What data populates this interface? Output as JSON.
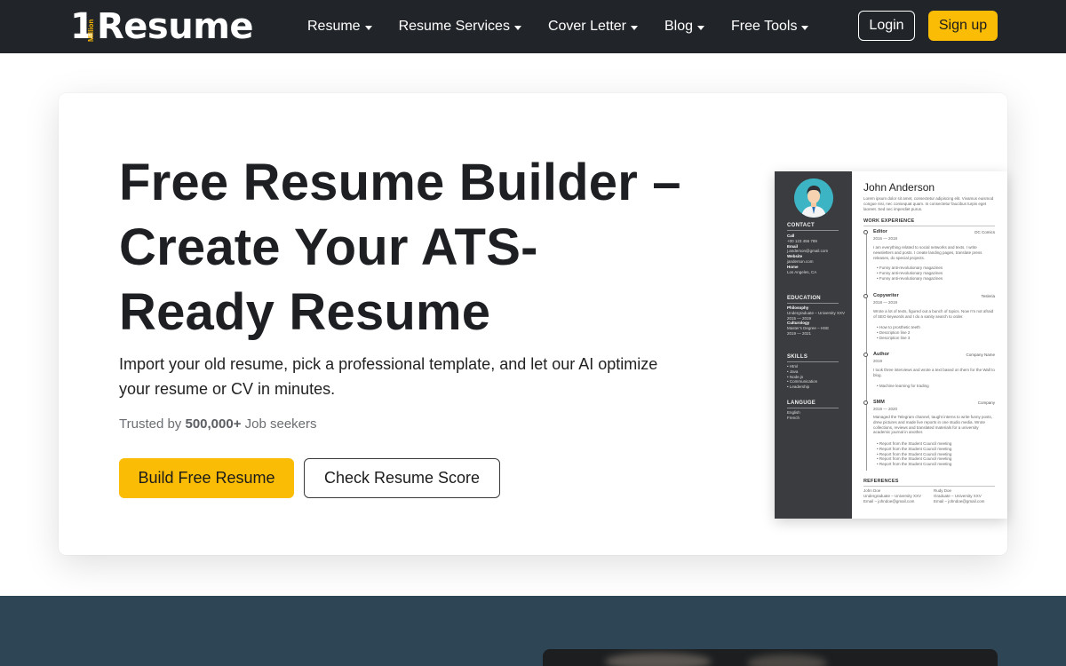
{
  "nav": {
    "logo_one": "1",
    "logo_million": "Million",
    "logo_word": "Resume",
    "menu": [
      {
        "label": "Resume"
      },
      {
        "label": "Resume Services"
      },
      {
        "label": "Cover Letter"
      },
      {
        "label": "Blog"
      },
      {
        "label": "Free Tools"
      }
    ],
    "login": "Login",
    "signup": "Sign up"
  },
  "hero": {
    "title": "Free Resume Builder – Create Your ATS-Ready Resume",
    "subtitle": "Import your old resume, pick a professional template, and let our AI optimize your resume or CV in minutes.",
    "trusted_prefix": "Trusted by",
    "trusted_count": "500,000+",
    "trusted_suffix": "Job seekers",
    "build_button": "Build Free Resume",
    "score_button": "Check Resume Score"
  },
  "preview": {
    "name": "John Anderson",
    "summary": "Lorem ipsum dolor sit amet, consectetur adipiscing elit. Vivamus euismod congue nisi, nec consequat quam. In consectetur faucibus turpis eget laoreet. Sed nec imperdiet purus.",
    "contact_heading": "CONTACT",
    "call_label": "Call",
    "call": "+00 123 456 789",
    "email_label": "Email",
    "email": "j.anderson@gmail.com",
    "website_label": "Website",
    "website": "janderson.com",
    "home_label": "Home",
    "home": "Los Angeles, CA",
    "education_heading": "EDUCATION",
    "edu1_title": "Philosophy",
    "edu1_detail": "Undergraduate – University XXV",
    "edu1_years": "2015 — 2019",
    "edu2_title": "Culturology",
    "edu2_detail": "Master's Degree – HSE",
    "edu2_years": "2019 — 2021",
    "skills_heading": "SKILLS",
    "skills": "• Html\n• Java\n• Node.js\n• Communication\n• Leadership",
    "language_heading": "LANGUGE",
    "languages": "English\nFrench",
    "work_heading": "WORK EXPERIENCE",
    "job1_title": "Editor",
    "job1_company": "DC Comics",
    "job1_years": "2016 — 2018",
    "job1_desc": "I am everything related to social networks and texts. I write newsletters and posts. I create landing pages, translate press releases, do special projects.",
    "job1_bullets": "• Funny anti-revolutionary magazines\n• Funny anti-revolutionary magazines\n• Funny anti-revolutionary magazines",
    "job2_title": "Copywriter",
    "job2_company": "Tesleria",
    "job2_years": "2018 — 2019",
    "job2_desc": "Wrote a lot of texts, figured out a bunch of topics. Now I'm not afraid of SEO keywords and I do a sanity search to order.",
    "job2_bullets": "• How to prosthetic teeth\n• Description line 2\n• Description line 3",
    "job3_title": "Author",
    "job3_company": "Company Name",
    "job3_years": "2019",
    "job3_desc": "I took three interviews and wrote a text based on them for the Wall to blog.",
    "job3_bullets": "• Machine learning for trading",
    "job4_title": "SMM",
    "job4_company": "Company",
    "job4_years": "2019 — 2020",
    "job4_desc": "Managed the Telegram channel, taught interns to write funny posts, drew pictures and made live reports in one studio media. Wrote collections, reviews and translated materials for a university academic journal in another.",
    "job4_bullets": "• Report from the Student Council meeting\n• Report from the Student Council meeting\n• Report from the Student Council meeting\n• Report from the Student Council meeting\n• Report from the Student Council meeting",
    "references_heading": "REFERENCES",
    "ref1": "John Doe\nUndergraduate – University XXV\nEmail – johndoe@gmail.com",
    "ref2": "Rudy Doe\nGraduate – University XXV\nEmail – johndoe@gmail.com"
  },
  "colors": {
    "nav_bg": "#212529",
    "accent": "#fbbc05",
    "bottom_bg": "#2e4555"
  }
}
